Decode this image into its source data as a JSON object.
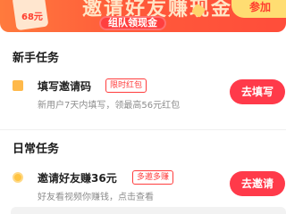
{
  "banner": {
    "money_tag": "68元",
    "headline": "邀请好友赚现金",
    "subtitle": "组队领现金",
    "join_label": "参加"
  },
  "sections": {
    "newbie_title": "新手任务",
    "daily_title": "日常任务"
  },
  "tasks": [
    {
      "title": "填写邀请码",
      "badge": "限时红包",
      "desc": "新用户7天内填写，领最高56元红包",
      "button": "去填写",
      "icon": "mail-icon"
    },
    {
      "title": "邀请好友赚36元",
      "badge": "多邀多赚",
      "desc": "好友看视频你赚钱，点击查看",
      "button": "去邀请",
      "icon": "coin-icon"
    }
  ],
  "colors": {
    "accent": "#ff3a4a",
    "banner_start": "#ff7a3d",
    "banner_end": "#ff4d3a",
    "join_bg": "#ffdd72"
  }
}
